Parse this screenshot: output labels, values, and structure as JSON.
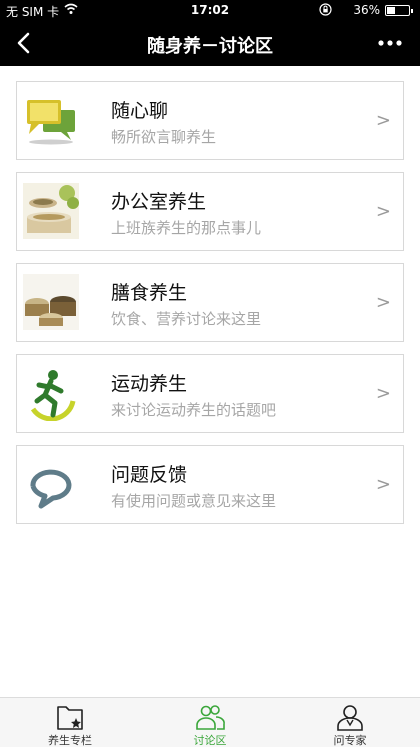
{
  "status_bar": {
    "carrier": "无 SIM 卡",
    "time": "17:02",
    "battery": "36%",
    "battery_level": 0.36
  },
  "nav": {
    "back_icon": "chevron-left-icon",
    "title": "随身养－讨论区",
    "more_icon": "more-dots-icon"
  },
  "topics": [
    {
      "title": "随心聊",
      "subtitle": "畅所欲言聊养生",
      "icon": "chat-bubbles-icon",
      "arrow": ">"
    },
    {
      "title": "办公室养生",
      "subtitle": "上班族养生的那点事儿",
      "icon": "office-tea-icon",
      "arrow": ">"
    },
    {
      "title": "膳食养生",
      "subtitle": "饮食、营养讨论来这里",
      "icon": "grain-food-icon",
      "arrow": ">"
    },
    {
      "title": "运动养生",
      "subtitle": "来讨论运动养生的话题吧",
      "icon": "running-man-icon",
      "arrow": ">"
    },
    {
      "title": "问题反馈",
      "subtitle": "有使用问题或意见来这里",
      "icon": "feedback-bubble-icon",
      "arrow": ">"
    }
  ],
  "tabs": [
    {
      "label": "养生专栏",
      "icon": "folder-star-icon",
      "active": false
    },
    {
      "label": "讨论区",
      "icon": "people-icon",
      "active": true
    },
    {
      "label": "问专家",
      "icon": "doctor-icon",
      "active": false
    }
  ],
  "colors": {
    "nav_bg": "#000000",
    "active_tab": "#3aa63a",
    "subtitle": "#a6a6a6"
  }
}
